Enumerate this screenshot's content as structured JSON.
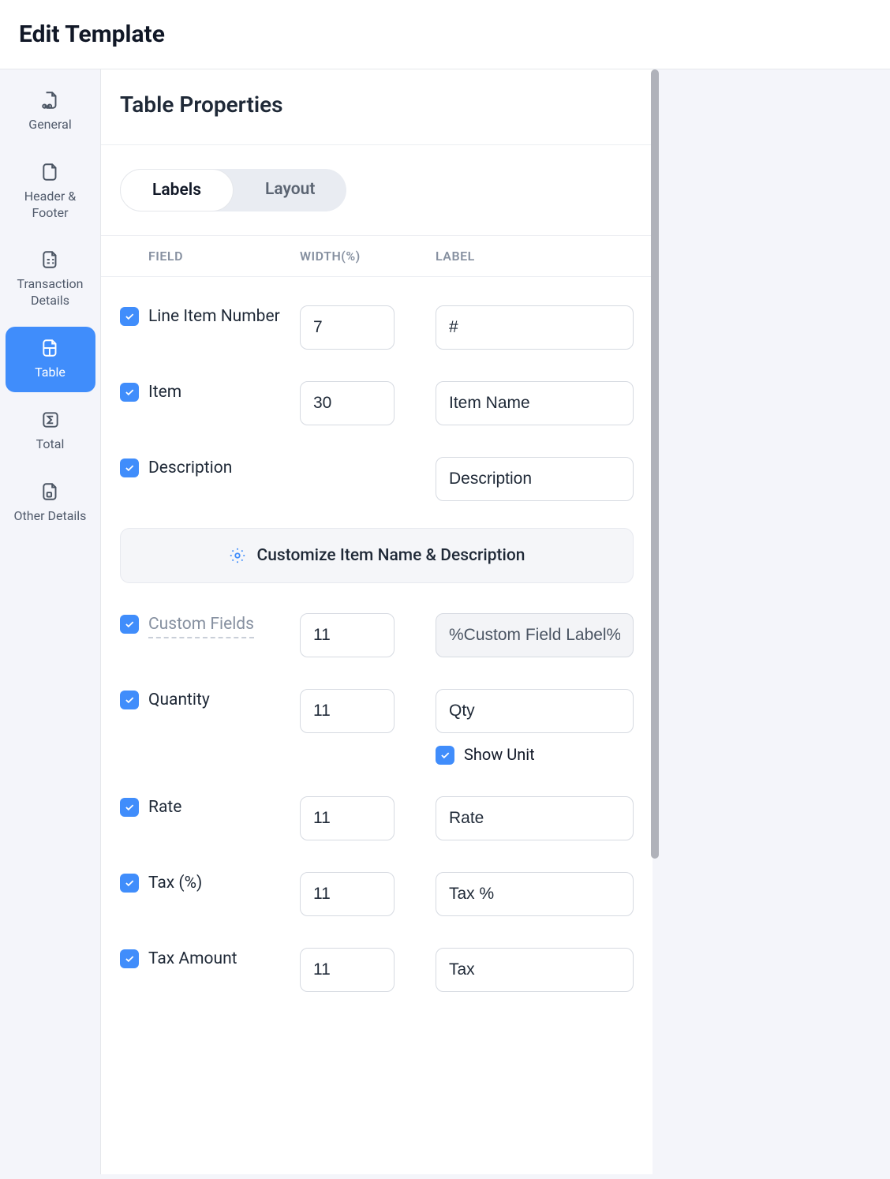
{
  "header": {
    "title": "Edit Template"
  },
  "sidebar": {
    "items": [
      {
        "label": "General"
      },
      {
        "label": "Header & Footer"
      },
      {
        "label": "Transaction Details"
      },
      {
        "label": "Table"
      },
      {
        "label": "Total"
      },
      {
        "label": "Other Details"
      }
    ]
  },
  "panel": {
    "title": "Table Properties"
  },
  "tabs": {
    "labels_tab": "Labels",
    "layout_tab": "Layout"
  },
  "columns": {
    "field": "FIELD",
    "width": "WIDTH(%)",
    "label": "LABEL"
  },
  "rows": {
    "line_item_number": {
      "field": "Line Item Number",
      "width": "7",
      "label": "#"
    },
    "item": {
      "field": "Item",
      "width": "30",
      "label": "Item Name"
    },
    "description": {
      "field": "Description",
      "label": "Description"
    },
    "custom_fields": {
      "field": "Custom Fields",
      "width": "11",
      "label": "%Custom Field Label%"
    },
    "quantity": {
      "field": "Quantity",
      "width": "11",
      "label": "Qty",
      "show_unit": "Show Unit"
    },
    "rate": {
      "field": "Rate",
      "width": "11",
      "label": "Rate"
    },
    "tax_pct": {
      "field": "Tax (%)",
      "width": "11",
      "label": "Tax %"
    },
    "tax_amount": {
      "field": "Tax Amount",
      "width": "11",
      "label": "Tax"
    }
  },
  "customize_button": "Customize Item Name & Description"
}
